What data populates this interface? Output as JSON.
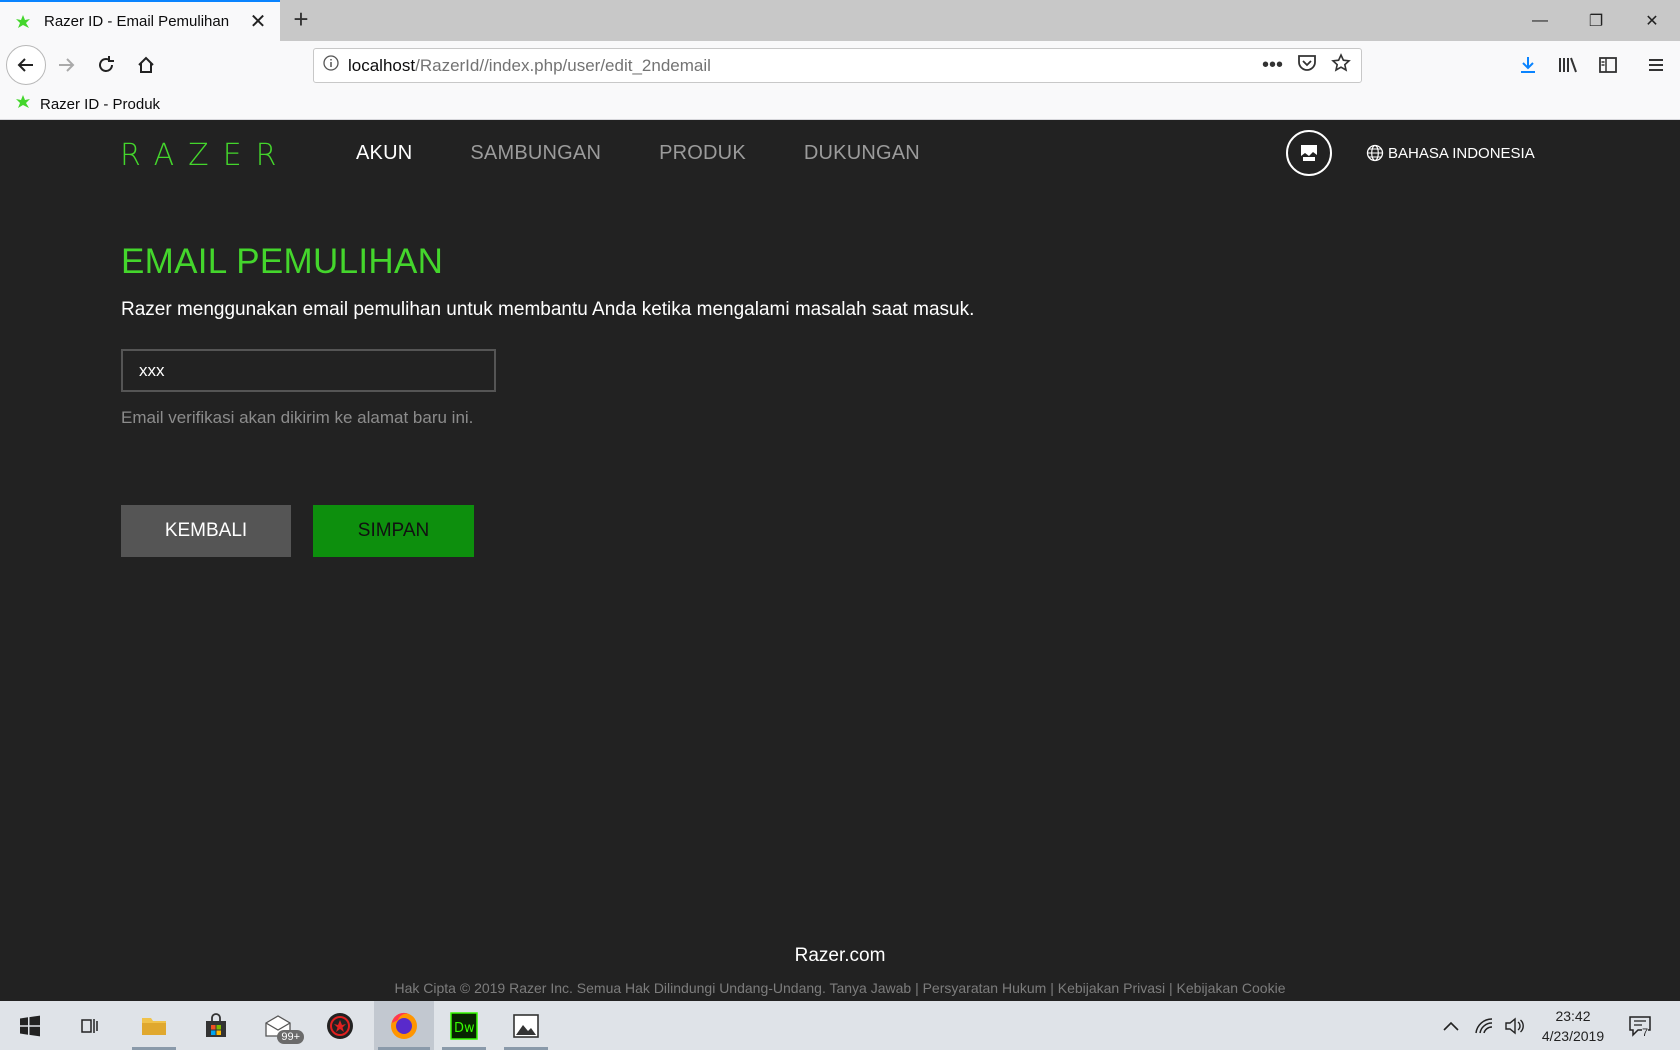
{
  "browser": {
    "tab_title": "Razer ID - Email Pemulihan",
    "url_host": "localhost",
    "url_path": "/RazerId//index.php/user/edit_2ndemail",
    "bookmark": "Razer ID - Produk"
  },
  "header": {
    "logo": "RAZER",
    "nav": [
      "AKUN",
      "SAMBUNGAN",
      "PRODUK",
      "DUKUNGAN"
    ],
    "language": "BAHASA INDONESIA"
  },
  "main": {
    "title": "EMAIL PEMULIHAN",
    "description": "Razer menggunakan email pemulihan untuk membantu Anda ketika mengalami masalah saat masuk.",
    "email_value": "xxx",
    "hint": "Email verifikasi akan dikirim ke alamat baru ini.",
    "back_label": "KEMBALI",
    "save_label": "SIMPAN"
  },
  "footer": {
    "brand": "Razer.com",
    "links": "Hak Cipta © 2019 Razer Inc. Semua Hak Dilindungi Undang-Undang. Tanya Jawab | Persyaratan Hukum | Kebijakan Privasi | Kebijakan Cookie"
  },
  "taskbar": {
    "mail_badge": "99+",
    "time": "23:42",
    "date": "4/23/2019",
    "notifications": "7"
  },
  "colors": {
    "accent": "#44d62c",
    "background": "#222222",
    "save_button": "#0d8f0d",
    "back_button": "#555555"
  }
}
